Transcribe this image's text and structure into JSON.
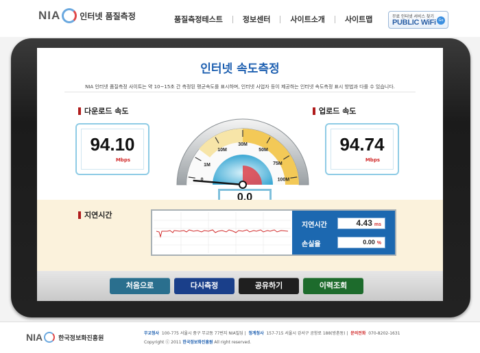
{
  "header": {
    "logo_mark": "NIA",
    "logo_text": "인터넷 품질측정",
    "nav": [
      "품질측정테스트",
      "정보센터",
      "사이트소개",
      "사이트맵"
    ],
    "wifi_badge": {
      "top": "무료 인터넷 서비스 찾기",
      "main": "PUBLIC WiFi",
      "dot": "Go"
    }
  },
  "screen": {
    "title": "인터넷 속도측정",
    "description": "NIA 인터넷 품질측정 사이트는 약 10~15초 간 측정된 평균속도를 표시하며, 인터넷 사업자 등이 제공하는 인터넷 속도측정 표시 방법과 다를 수 있습니다.",
    "download": {
      "label": "다운로드 속도",
      "value": "94.10",
      "unit": "Mbps"
    },
    "upload": {
      "label": "업로드 속도",
      "value": "94.74",
      "unit": "Mbps"
    },
    "gauge": {
      "ticks": [
        "0",
        "1M",
        "10M",
        "30M",
        "50M",
        "75M",
        "100M"
      ],
      "needle_fraction": 0.0,
      "current": "0.0"
    },
    "latency": {
      "section_label": "지연시간",
      "latency_label": "지연시간",
      "latency_value": "4.43",
      "latency_unit": "ms",
      "loss_label": "손실율",
      "loss_value": "0.00",
      "loss_unit": "%"
    },
    "buttons": [
      {
        "label": "처음으로",
        "color": "#2a6f8e"
      },
      {
        "label": "다시측정",
        "color": "#1a3f8a"
      },
      {
        "label": "공유하기",
        "color": "#1f1f1f"
      },
      {
        "label": "이력조회",
        "color": "#1d6b2c"
      }
    ]
  },
  "footer": {
    "logo_mark": "NIA",
    "org": "한국정보화진흥원",
    "hq_label": "무교청사",
    "hq_addr": "100-775 서울시 중구 무교동 77번지 NIA빌딩",
    "branch_label": "청계청사",
    "branch_addr": "157-715 서울시 강서구 공항로 188(방촌동)",
    "contact_label": "문의전화",
    "contact": "070-8202-1631",
    "copyright_pre": "Copyright ⓒ 2011",
    "copyright_org": "한국정보화진흥원",
    "copyright_post": "All right reserved."
  },
  "colors": {
    "accent_blue": "#1d5fb0",
    "red": "#d12b2b",
    "panel_blue": "#1c68b0"
  }
}
